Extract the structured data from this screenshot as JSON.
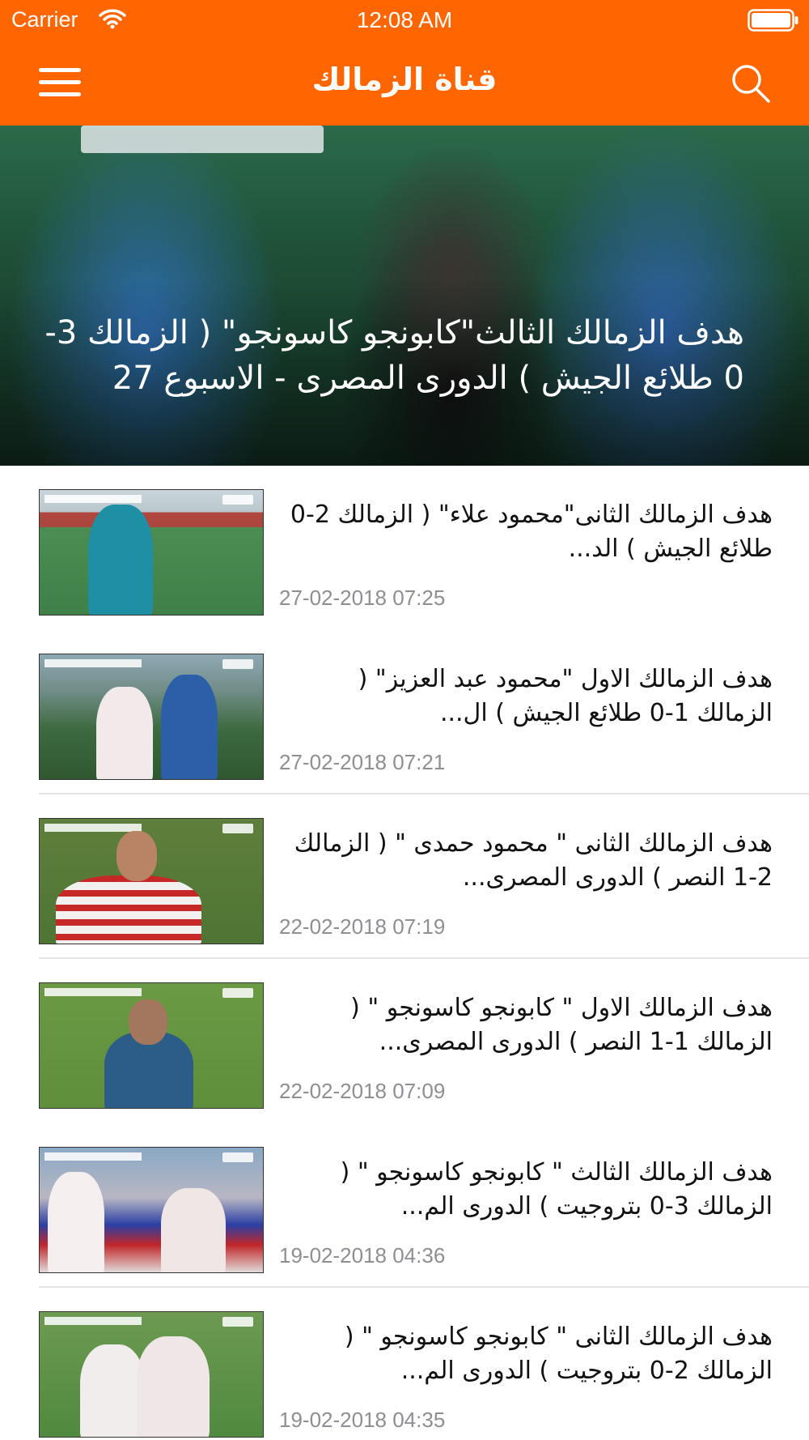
{
  "status_bar": {
    "carrier": "Carrier",
    "time": "12:08 AM"
  },
  "nav": {
    "title": "قناة الزمالك",
    "menu_icon": "hamburger-menu-icon",
    "search_icon": "search-icon"
  },
  "colors": {
    "brand": "#ff6600",
    "date_text": "#8e8e93"
  },
  "hero": {
    "title": "هدف الزمالك الثالث\"كابونجو كاسونجو\" ( الزمالك 3-0 طلائع الجيش ) الدورى المصرى - الاسبوع 27"
  },
  "items": [
    {
      "title": "هدف الزمالك الثانى\"محمود علاء\" ( الزمالك 2-0 طلائع الجيش ) الد...",
      "date": "27-02-2018 07:25"
    },
    {
      "title": "هدف الزمالك الاول \"محمود عبد العزيز\" ( الزمالك 1-0 طلائع الجيش ) ال...",
      "date": "27-02-2018 07:21"
    },
    {
      "title": "هدف الزمالك الثانى \" محمود حمدى \" ( الزمالك 2-1 النصر ) الدورى المصرى...",
      "date": "22-02-2018 07:19"
    },
    {
      "title": "هدف الزمالك الاول \" كابونجو كاسونجو \" ( الزمالك 1-1 النصر ) الدورى المصرى...",
      "date": "22-02-2018 07:09"
    },
    {
      "title": "هدف الزمالك الثالث \" كابونجو كاسونجو \" ( الزمالك 3-0 بتروجيت ) الدورى الم...",
      "date": "19-02-2018 04:36"
    },
    {
      "title": "هدف الزمالك الثانى \" كابونجو كاسونجو \" ( الزمالك 2-0 بتروجيت ) الدورى الم...",
      "date": "19-02-2018 04:35"
    }
  ]
}
